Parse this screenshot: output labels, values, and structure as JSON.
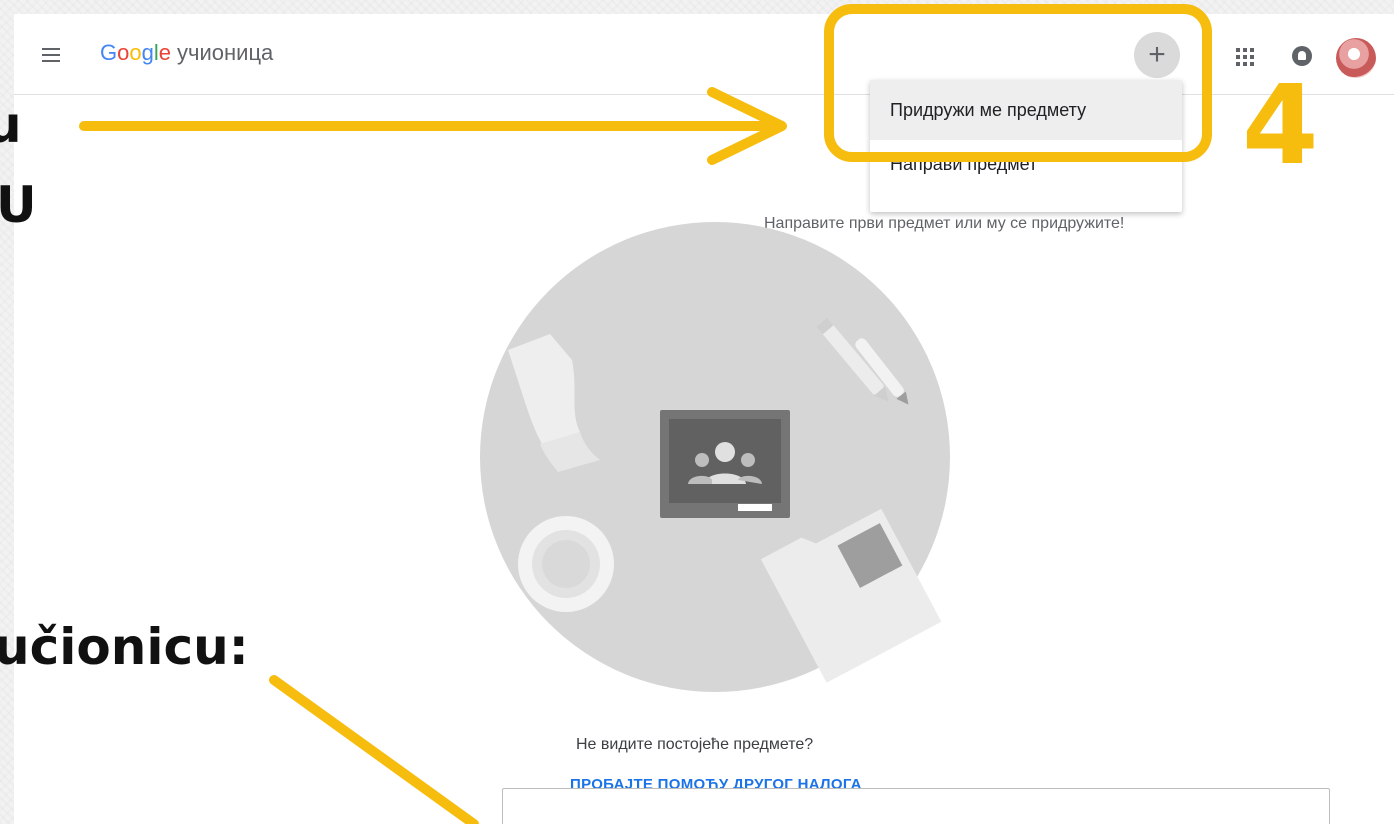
{
  "appbar": {
    "logo_letters": [
      {
        "ch": "G",
        "color": "#4285F4"
      },
      {
        "ch": "o",
        "color": "#EA4335"
      },
      {
        "ch": "o",
        "color": "#FBBC05"
      },
      {
        "ch": "g",
        "color": "#4285F4"
      },
      {
        "ch": "l",
        "color": "#34A853"
      },
      {
        "ch": "e",
        "color": "#EA4335"
      }
    ],
    "product_name": "учионица",
    "add_button_symbol": "+",
    "apps_icon": "apps-grid-icon",
    "notifications_icon": "bell-icon",
    "avatar_icon": "account-avatar"
  },
  "menu": {
    "items": [
      {
        "label": "Придружи ме предмету"
      },
      {
        "label": "Направи предмет"
      }
    ]
  },
  "main": {
    "prompt": "Направите први предмет или му се придружите!",
    "no_classes_question": "Не видите постојеће предмете?",
    "try_other_account": "ПРОБАЈТЕ ПОМОЋУ ДРУГОГ НАЛОГА"
  },
  "slide_background": {
    "fragment_1": "u",
    "fragment_2": "U",
    "fragment_3": "učionicu:"
  },
  "annotation": {
    "step_number": "4",
    "color": "#f6bd0f"
  }
}
